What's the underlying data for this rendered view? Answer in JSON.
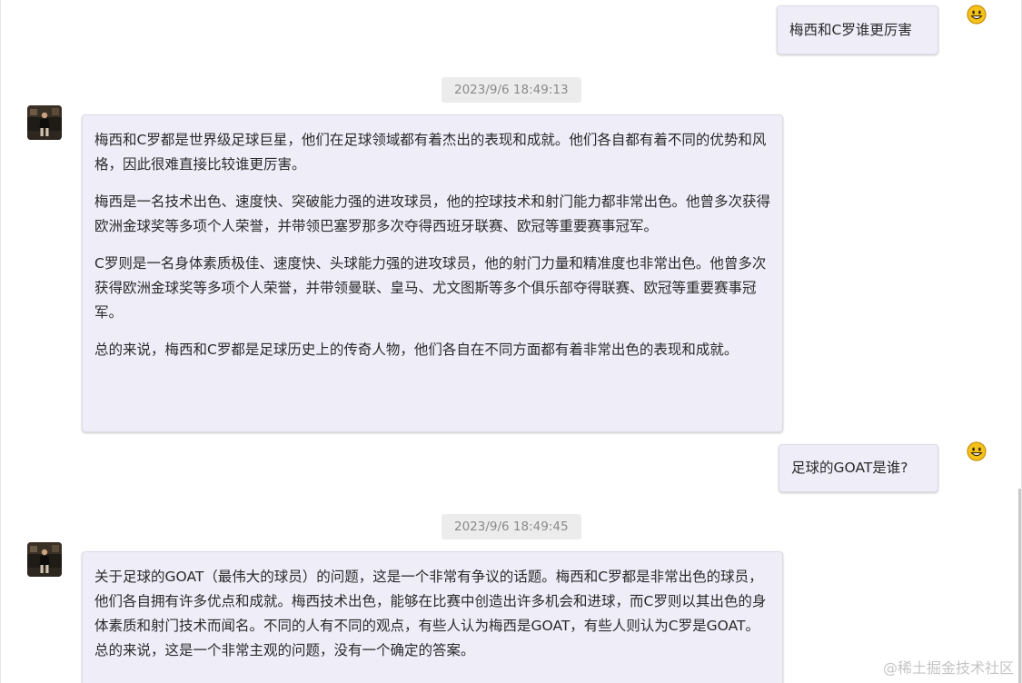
{
  "messages": [
    {
      "role": "user",
      "text": "梅西和C罗谁更厉害",
      "icon": "smiley-icon"
    },
    {
      "role": "timestamp",
      "text": "2023/9/6 18:49:13"
    },
    {
      "role": "assistant",
      "icon": "avatar",
      "paragraphs": [
        "梅西和C罗都是世界级足球巨星，他们在足球领域都有着杰出的表现和成就。他们各自都有着不同的优势和风格，因此很难直接比较谁更厉害。",
        "梅西是一名技术出色、速度快、突破能力强的进攻球员，他的控球技术和射门能力都非常出色。他曾多次获得欧洲金球奖等多项个人荣誉，并带领巴塞罗那多次夺得西班牙联赛、欧冠等重要赛事冠军。",
        "C罗则是一名身体素质极佳、速度快、头球能力强的进攻球员，他的射门力量和精准度也非常出色。他曾多次获得欧洲金球奖等多项个人荣誉，并带领曼联、皇马、尤文图斯等多个俱乐部夺得联赛、欧冠等重要赛事冠军。",
        "总的来说，梅西和C罗都是足球历史上的传奇人物，他们各自在不同方面都有着非常出色的表现和成就。"
      ]
    },
    {
      "role": "user",
      "text": "足球的GOAT是谁?",
      "icon": "smiley-icon"
    },
    {
      "role": "timestamp",
      "text": "2023/9/6 18:49:45"
    },
    {
      "role": "assistant",
      "icon": "avatar",
      "paragraphs": [
        "关于足球的GOAT（最伟大的球员）的问题，这是一个非常有争议的话题。梅西和C罗都是非常出色的球员，他们各自拥有许多优点和成就。梅西技术出色，能够在比赛中创造出许多机会和进球，而C罗则以其出色的身体素质和射门技术而闻名。不同的人有不同的观点，有些人认为梅西是GOAT，有些人则认为C罗是GOAT。总的来说，这是一个非常主观的问题，没有一个确定的答案。"
      ]
    }
  ],
  "watermark": "@稀土掘金技术社区",
  "colors": {
    "bubble_bg": "#eeedf8",
    "timestamp_bg": "#ececec",
    "timestamp_text": "#8a8a8a",
    "smiley": "#f5c21b"
  }
}
